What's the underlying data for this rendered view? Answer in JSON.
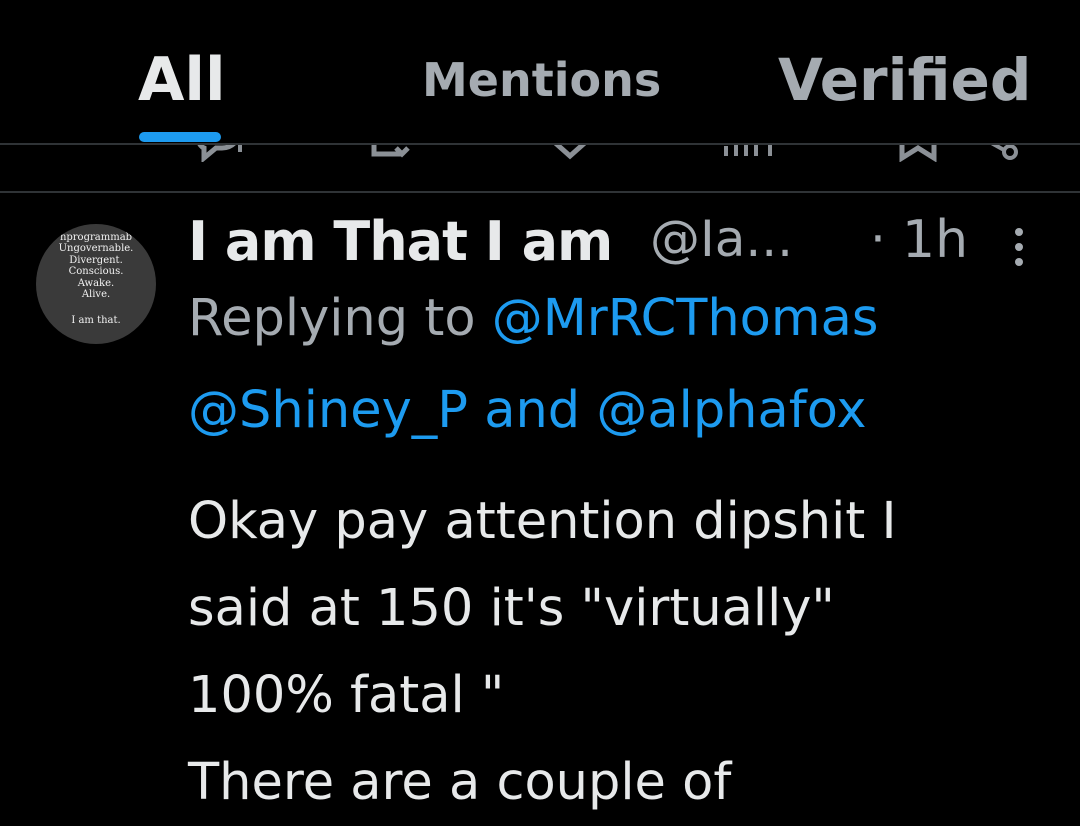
{
  "tabs": [
    {
      "label": "All",
      "active": true
    },
    {
      "label": "Mentions",
      "active": false
    },
    {
      "label": "Verified",
      "active": false
    }
  ],
  "colors": {
    "background": "#000000",
    "text_primary": "#e7e9ea",
    "text_secondary": "#a5abb1",
    "accent": "#1d9bf0",
    "divider": "#2f3336"
  },
  "previous_tweet_actions": {
    "icons": [
      "reply-icon",
      "retweet-icon",
      "like-icon",
      "views-icon",
      "bookmark-icon",
      "share-icon"
    ]
  },
  "tweet": {
    "avatar_text": [
      "nprogrammab",
      "Ungovernable.",
      "Divergent.",
      "Conscious.",
      "Awake.",
      "Alive.",
      "I am that."
    ],
    "display_name": "I am That I am",
    "handle": "@Ia...",
    "separator": "·",
    "time": "1h",
    "replying_prefix": "Replying to ",
    "mentions": [
      "@MrRCThomas",
      "@Shiney_P",
      "@alphafox"
    ],
    "mentions_joiner": " and ",
    "text_lines": [
      "Okay pay attention dipshit I",
      "said at 150 it's \"virtually\"",
      "100% fatal \"",
      "There are a couple of"
    ]
  }
}
